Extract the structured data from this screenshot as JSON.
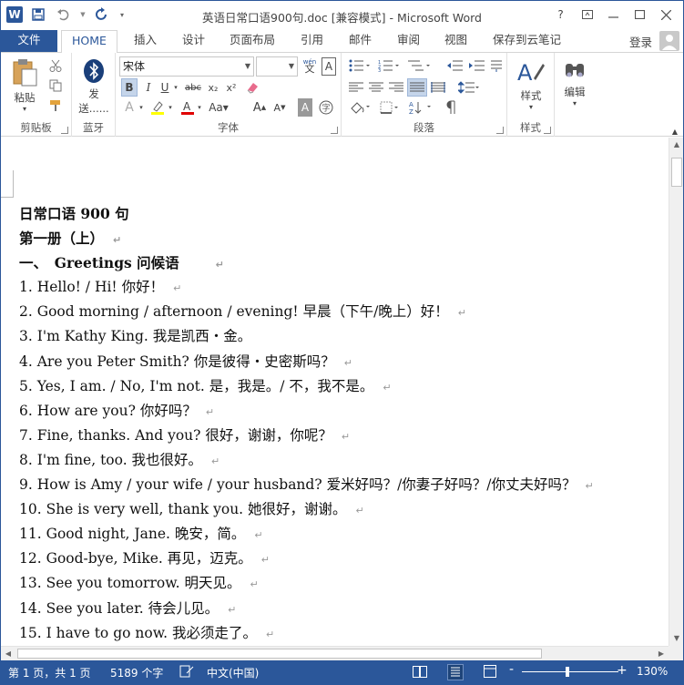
{
  "window": {
    "title": "英语日常口语900句.doc [兼容模式] - Microsoft Word",
    "help": "?",
    "login": "登录"
  },
  "tabs": [
    "文件",
    "HOME",
    "插入",
    "设计",
    "页面布局",
    "引用",
    "邮件",
    "审阅",
    "视图",
    "保存到云笔记"
  ],
  "ribbon": {
    "clipboard": {
      "paste": "粘贴",
      "label": "剪贴板"
    },
    "bluetooth": {
      "send": "发",
      "send2": "送......",
      "label": "蓝牙"
    },
    "font": {
      "name": "宋体",
      "size": "",
      "label": "字体",
      "wen": "wén",
      "wen_char": "文"
    },
    "paragraph": {
      "label": "段落"
    },
    "styles": {
      "btn": "样式",
      "label": "样式"
    },
    "editing": {
      "btn": "编辑"
    }
  },
  "document": {
    "lines": [
      "日常口语 900 句",
      "第一册（上）",
      "一、　Greetings  问候语",
      "1. Hello! / Hi!  你好！",
      "2. Good morning / afternoon / evening!  早晨（下午/晚上）好！",
      "3. I'm Kathy King.  我是凯西・金。",
      "4. Are you Peter Smith?  你是彼得・史密斯吗？",
      "5. Yes, I am. / No, I'm not.  是，我是。/  不，我不是。",
      "6. How are you?  你好吗？",
      "7. Fine, thanks. And you?  很好，谢谢，你呢？",
      "8. I'm fine, too.  我也很好。",
      "9. How is Amy / your wife / your husband?  爱米好吗？/你妻子好吗？/你丈夫好吗？",
      "10. She is very well, thank you.  她很好，谢谢。",
      "11. Good night, Jane.  晚安，简。",
      "12. Good-bye, Mike.  再见，迈克。",
      "13. See you tomorrow.  明天见。",
      "14. See you later.  待会儿见。",
      "15. I have to go now.  我必须走了。"
    ],
    "paragraph_mark": "↵"
  },
  "status": {
    "page": "第 1 页，共 1 页",
    "words": "5189 个字",
    "lang": "中文(中国)",
    "zoom": "130%",
    "zoom_minus": "-",
    "zoom_plus": "+"
  }
}
